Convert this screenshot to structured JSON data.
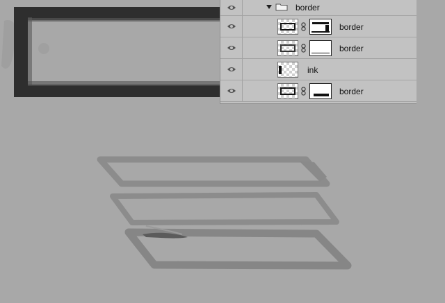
{
  "layers_panel": {
    "group": {
      "name": "border",
      "expanded": true,
      "icon": "folder-icon"
    },
    "layers": [
      {
        "name": "border",
        "has_mask": true,
        "mask_variant": "top-bottom",
        "visible": true
      },
      {
        "name": "border",
        "has_mask": true,
        "mask_variant": "bottom",
        "visible": true
      },
      {
        "name": "ink",
        "has_mask": false,
        "visible": true
      },
      {
        "name": "border",
        "has_mask": true,
        "mask_variant": "bottom-bar",
        "visible": true
      }
    ]
  },
  "colors": {
    "canvas_background": "#a8a8a8",
    "panel_background": "#c2c2c2",
    "ink_dark": "#2a2a2a",
    "ink_light": "#8a8a8a"
  }
}
